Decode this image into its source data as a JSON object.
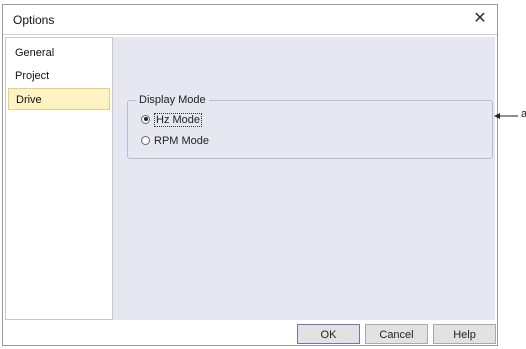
{
  "window": {
    "title": "Options",
    "close_glyph": "✕"
  },
  "sidebar": {
    "items": [
      {
        "label": "General",
        "selected": false
      },
      {
        "label": "Project",
        "selected": false
      },
      {
        "label": "Drive",
        "selected": true
      }
    ]
  },
  "display_mode": {
    "group_title": "Display Mode",
    "options": [
      {
        "label": "Hz Mode",
        "checked": true
      },
      {
        "label": "RPM Mode",
        "checked": false
      }
    ]
  },
  "buttons": {
    "ok": "OK",
    "cancel": "Cancel",
    "help": "Help"
  },
  "annotation": {
    "label": "a"
  },
  "colors": {
    "content_bg": "#e6e7f0",
    "selected_bg": "#fff3c4"
  }
}
